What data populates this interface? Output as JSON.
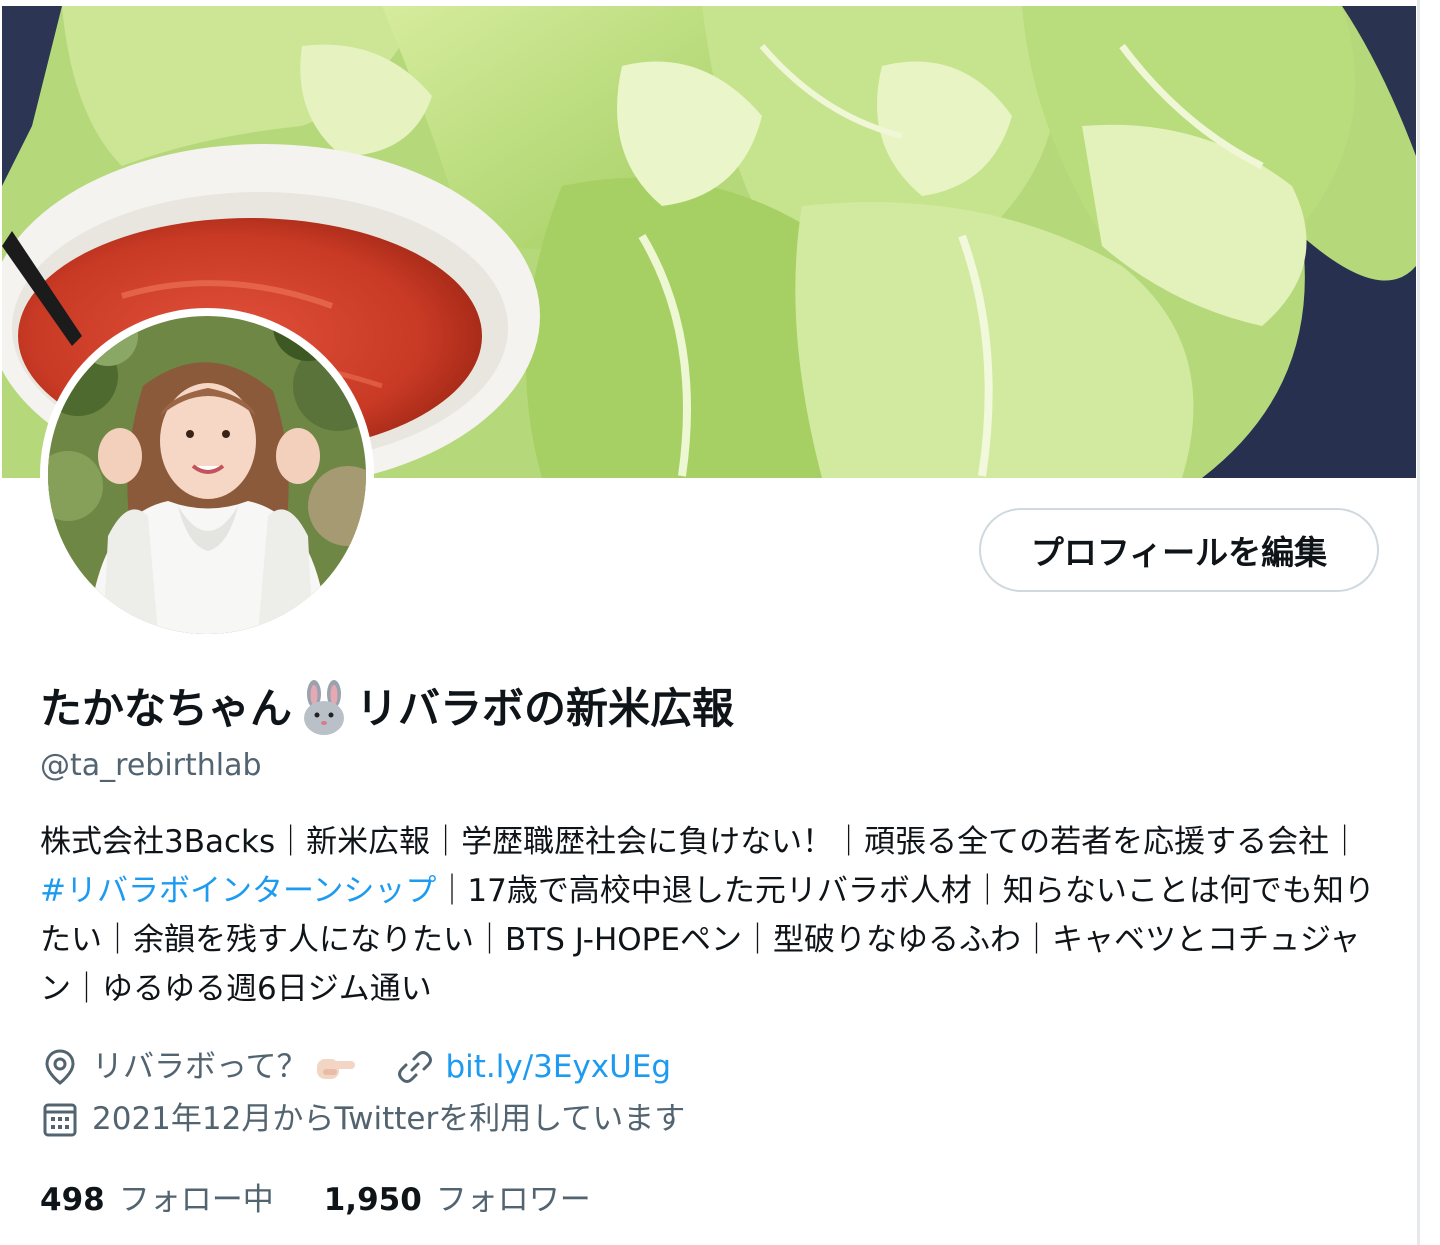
{
  "profile": {
    "edit_button": "プロフィールを編集",
    "name_before": "たかなちゃん",
    "name_after": "リバラボの新米広報",
    "name_icon": "rabbit-face-icon",
    "handle": "@ta_rebirthlab",
    "bio_1": "株式会社3Backs｜新米広報｜学歴職歴社会に負けない！｜頑張る全ての若者を応援する会社｜",
    "bio_hashtag": "#リバラボインターンシップ",
    "bio_2": "｜17歳で高校中退した元リバラボ人材｜知らないことは何でも知りたい｜余韻を残す人になりたい｜BTS J-HOPEペン｜型破りなゆるふわ｜キャベツとコチュジャン｜ゆるゆる週6日ジム通い",
    "location": "リバラボって？",
    "location_icon": "location-pin-icon",
    "location_emoji": "pointing-hand-icon",
    "url": "bit.ly/3EyxUEg",
    "url_icon": "link-icon",
    "joined": "2021年12月からTwitterを利用しています",
    "joined_icon": "calendar-icon",
    "following_count": "498",
    "following_label": "フォロー中",
    "followers_count": "1,950",
    "followers_label": "フォロワー"
  },
  "colors": {
    "accent": "#1d9bf0",
    "secondary_text": "#536471",
    "primary_text": "#0f1419",
    "button_border": "#cfd9de"
  }
}
